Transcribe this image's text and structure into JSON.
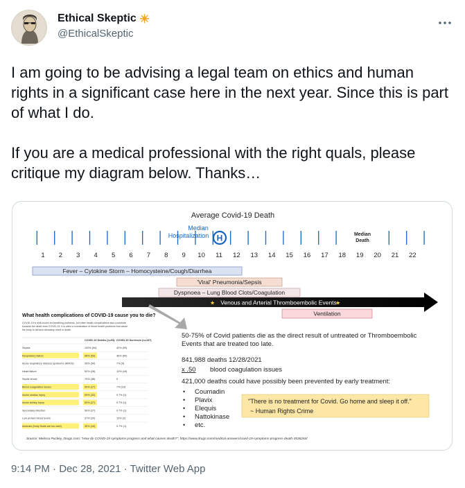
{
  "tweet": {
    "author_name": "Ethical Skeptic",
    "author_emoji": "☀",
    "handle": "@EthicalSkeptic",
    "more_icon": "more-horizontal-icon",
    "paragraph1": "I am going to be advising a legal team on ethics and human rights in a significant case here in the next year. Since this is part of what I do.",
    "paragraph2": "If you are a medical professional with the right quals, please critique my diagram below. Thanks…",
    "time": "9:14 PM",
    "date": "Dec 28, 2021",
    "source": "Twitter Web App",
    "sep": "·"
  },
  "diagram": {
    "title": "Average Covid-19 Death",
    "days": [
      "1",
      "2",
      "3",
      "4",
      "5",
      "6",
      "7",
      "8",
      "9",
      "10",
      "11",
      "12",
      "13",
      "14",
      "15",
      "16",
      "17",
      "18",
      "19",
      "20",
      "21",
      "22"
    ],
    "median_hosp_label_1": "Median",
    "median_hosp_label_2": "Hospitalization",
    "hosp_icon": "H",
    "median_death_label_1": "Median",
    "median_death_label_2": "Death",
    "bar_fever": "Fever – Cytokine Storm – Homocysteine/Cough/Diarrhea",
    "bar_pneumonia": "'Viral' Pneumonia/Sepsis",
    "bar_dyspnoea": "Dyspnoea – Lung Blood Clots/Coagulation",
    "bar_thrombo": "Venous and Arterial Thromboembolic Events",
    "bar_ventilation": "Ventilation",
    "article_title": "What health complications of COVID-19 cause you to die?",
    "article_body_1": "COVID-19 is well known for breathing problems, but other health complications also contribute",
    "article_body_2": "towards the death from COVID-19. It is often a combination of these health problems that cause",
    "article_body_3": "the body to fail and ultimately result in death.",
    "table_headers": [
      "",
      "COVID-19 Deaths (n=54)",
      "COVID-19 Survivors (n=137)"
    ],
    "table_rows": [
      [
        "Sepsis",
        "100% (54)",
        "42% (59)"
      ],
      [
        "Respiratory failure",
        "98% (53)",
        "36% (50)"
      ],
      [
        "Acute respiratory distress syndrome (ARDS)",
        "93% (50)",
        "7% (9)"
      ],
      [
        "Heart failure",
        "52% (28)",
        "12% (16)"
      ],
      [
        "Septic shock",
        "70% (38)",
        "0"
      ],
      [
        "Blood coagulation issues",
        "50% (27)",
        "7% (10)"
      ],
      [
        "Acute cardiac injury",
        "59% (32)",
        "0.7% (1)"
      ],
      [
        "Acute kidney injury",
        "50% (27)",
        "0.7% (1)"
      ],
      [
        "Secondary infection",
        "50% (27)",
        "0.7% (1)"
      ],
      [
        "Low protein blood levels",
        "37% (20)",
        "13% (2)"
      ],
      [
        "Acidosis (body fluids are too acid)",
        "30% (16)",
        "0.7% (1)"
      ]
    ],
    "stat_intro": "50-75% of Covid patients die as the direct result of untreated or Thromboembolic Events that are treated too late.",
    "deaths_line": "841,988  deaths 12/28/2021",
    "coag_mult": "x .50",
    "coag_text": "blood coagulation issues",
    "prevented_line": "421,000 deaths could have possibly been prevented by early treatment:",
    "drugs": [
      "Coumadin",
      "Plavix",
      "Elequis",
      "Nattokinase",
      "etc."
    ],
    "quote": "\"There is no treatment for Covid. Go home and sleep it off.\"",
    "quote_attr": "~ Human Rights Crime",
    "source_line": "Source: Melissa Puckey, Drugs.com; \"How do COVID-19 symptoms progress and what causes death?\"; https://www.drugs.com/medical-answers/covid-19-symptoms-progress-death-3536264/"
  },
  "colors": {
    "accent_blue": "#1565c0",
    "fever_fill": "#dbe3f3",
    "pneumonia_fill": "#f5ddd2",
    "ventilation_fill": "#f9d9dc",
    "highlight": "#fff07a",
    "quote_fill": "#fde6a6"
  }
}
